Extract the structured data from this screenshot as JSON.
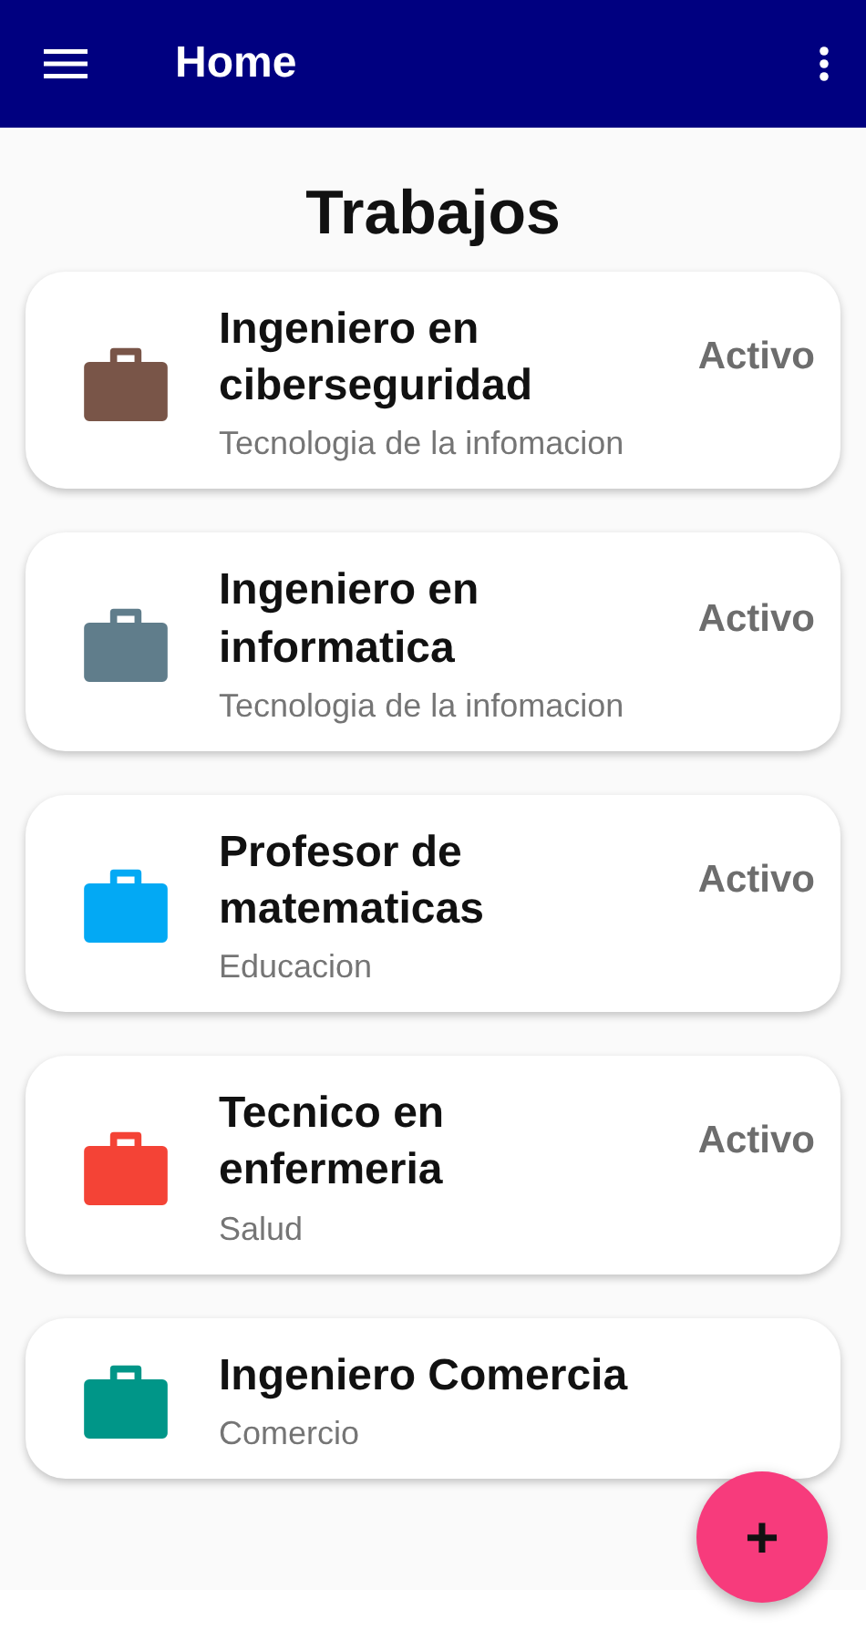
{
  "app_bar": {
    "title": "Home"
  },
  "heading": "Trabajos",
  "jobs": [
    {
      "title": "Ingeniero en ciberseguridad",
      "category": "Tecnologia de la infomacion",
      "status": "Activo",
      "color": "#795548"
    },
    {
      "title": "Ingeniero en informatica",
      "category": "Tecnologia de la infomacion",
      "status": "Activo",
      "color": "#607d8b"
    },
    {
      "title": "Profesor de matematicas",
      "category": "Educacion",
      "status": "Activo",
      "color": "#03a9f4"
    },
    {
      "title": "Tecnico en enfermeria",
      "category": "Salud",
      "status": "Activo",
      "color": "#f44336"
    },
    {
      "title": "Ingeniero Comercia",
      "category": "Comercio",
      "color": "#009688"
    }
  ],
  "fab": {
    "label": "+"
  }
}
